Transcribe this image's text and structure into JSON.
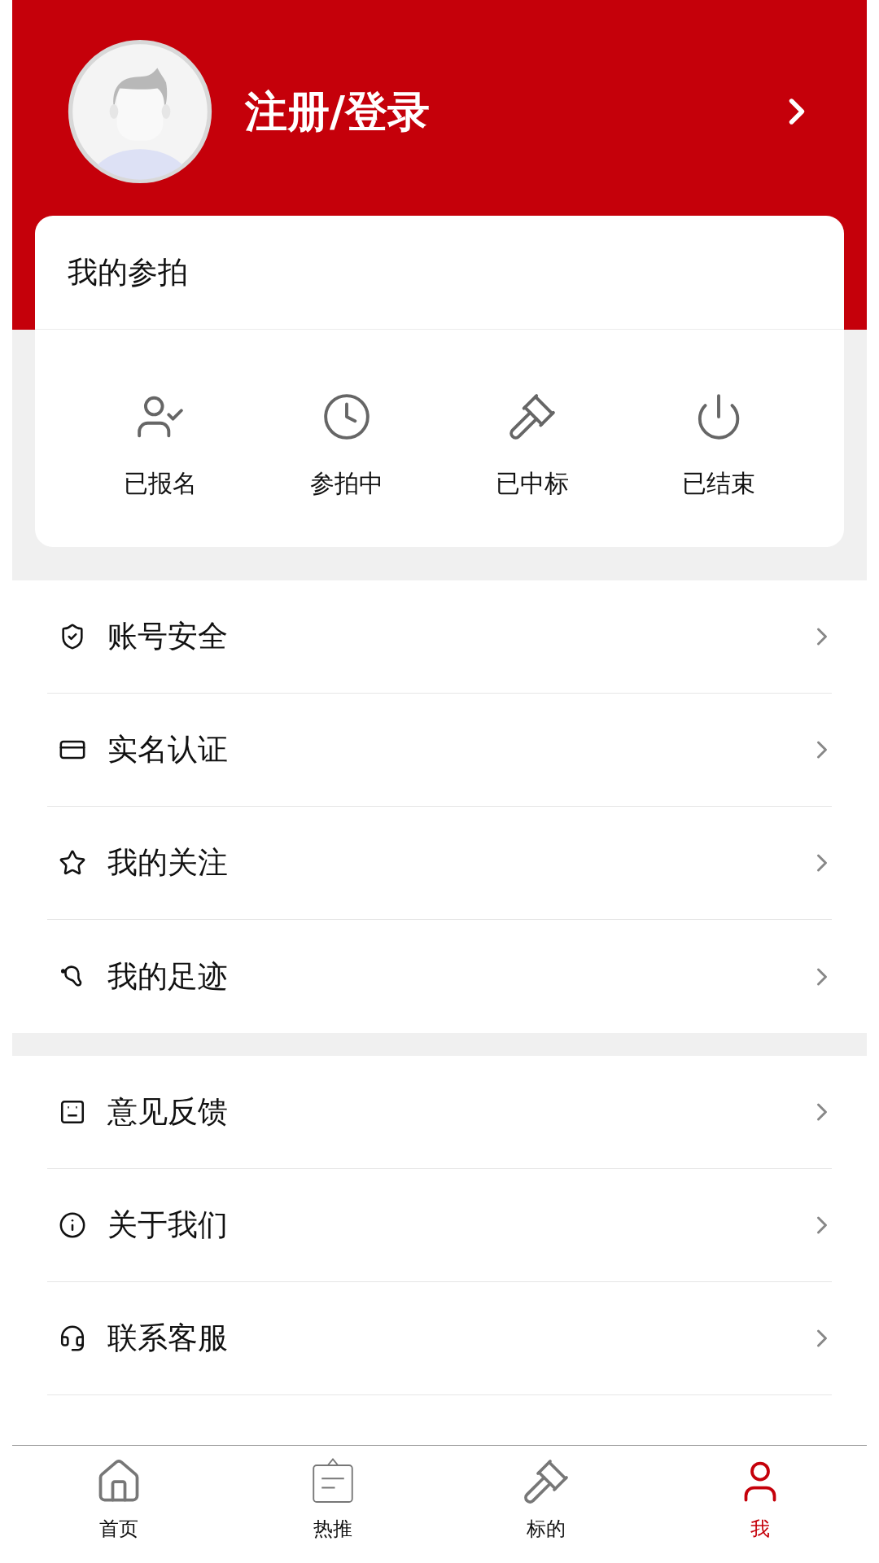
{
  "header": {
    "title": "注册/登录"
  },
  "participation": {
    "title": "我的参拍",
    "items": [
      {
        "kind": "registered",
        "label": "已报名"
      },
      {
        "kind": "ongoing",
        "label": "参拍中"
      },
      {
        "kind": "won",
        "label": "已中标"
      },
      {
        "kind": "ended",
        "label": "已结束"
      }
    ]
  },
  "menu_groups": [
    [
      {
        "kind": "security",
        "label": "账号安全"
      },
      {
        "kind": "identity",
        "label": "实名认证"
      },
      {
        "kind": "favorites",
        "label": "我的关注"
      },
      {
        "kind": "history",
        "label": "我的足迹"
      }
    ],
    [
      {
        "kind": "feedback",
        "label": "意见反馈"
      },
      {
        "kind": "about",
        "label": "关于我们"
      },
      {
        "kind": "service",
        "label": "联系客服"
      }
    ]
  ],
  "bottom_nav": [
    {
      "kind": "home",
      "label": "首页",
      "selected": false
    },
    {
      "kind": "hot",
      "label": "热推",
      "selected": false
    },
    {
      "kind": "lots",
      "label": "标的",
      "selected": false
    },
    {
      "kind": "me",
      "label": "我",
      "selected": true
    }
  ]
}
